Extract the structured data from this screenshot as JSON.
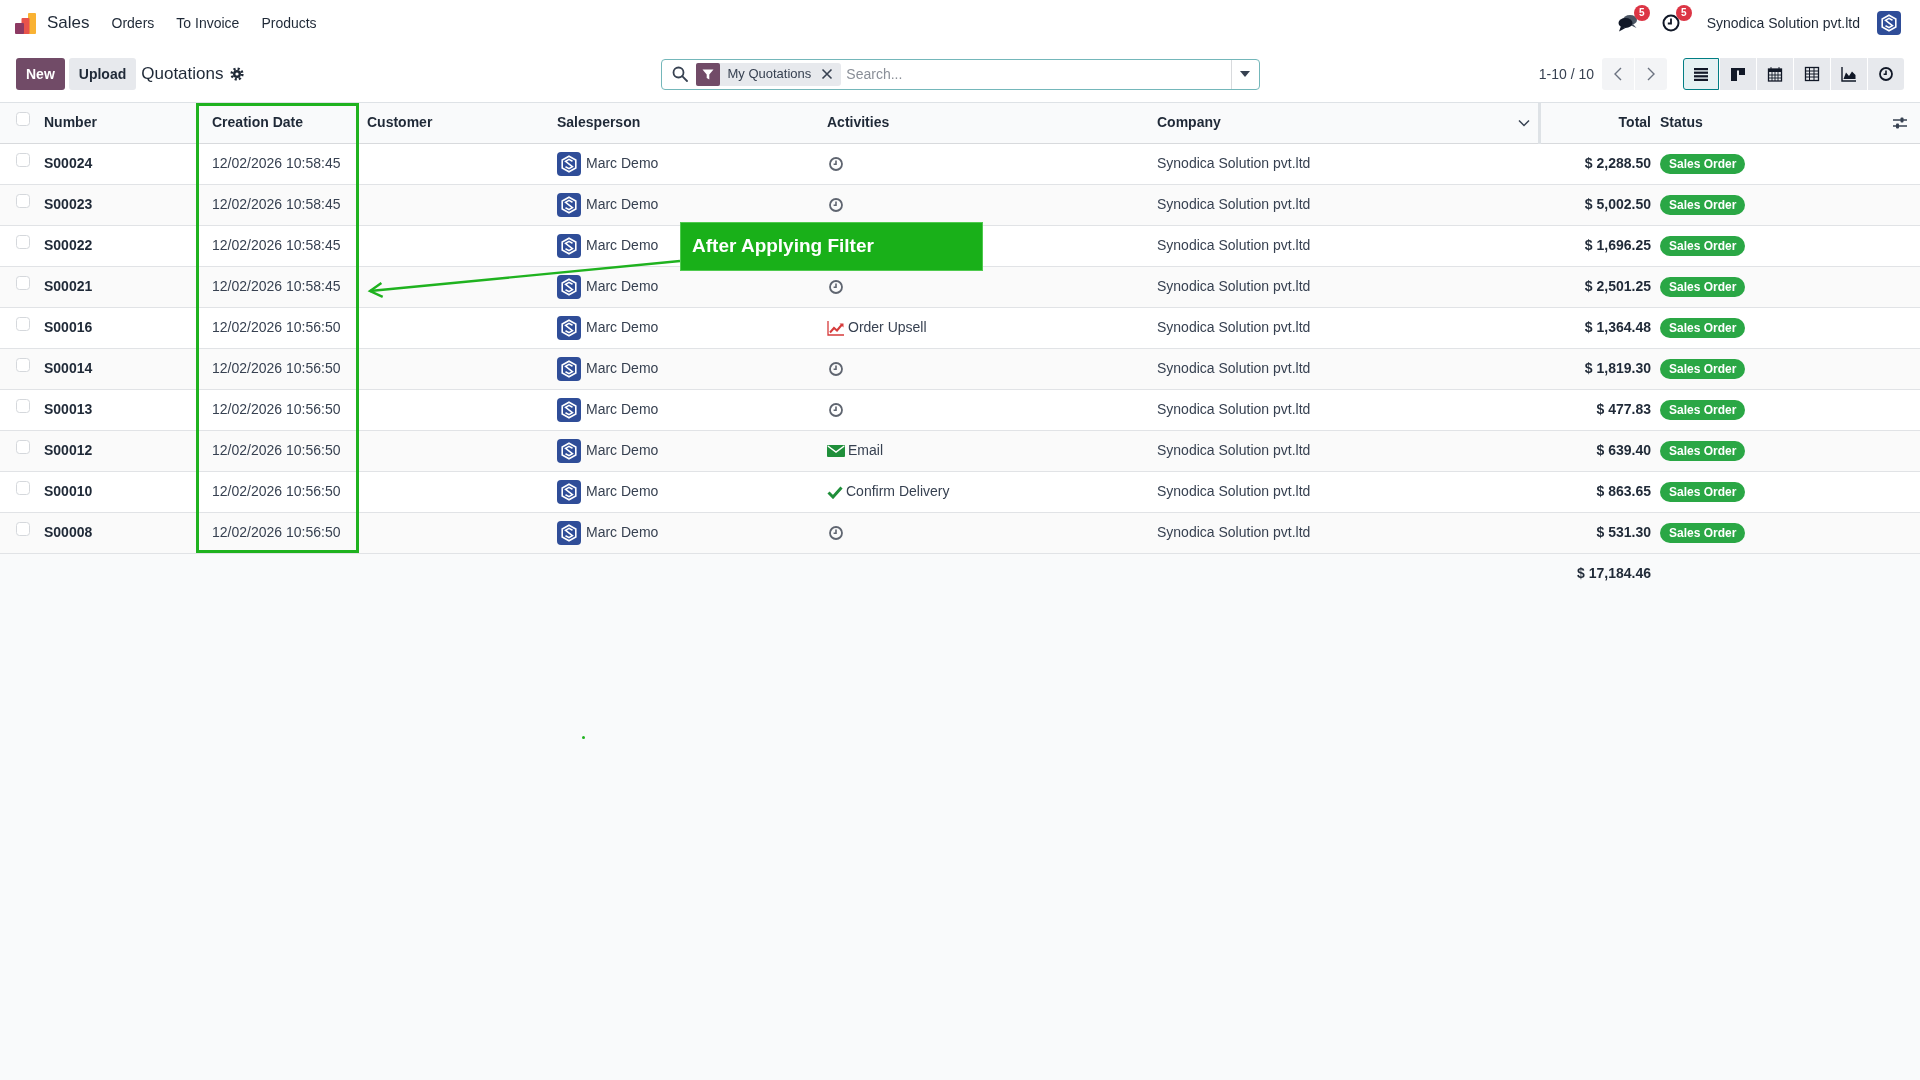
{
  "navbar": {
    "app_name": "Sales",
    "menu": [
      "Orders",
      "To Invoice",
      "Products"
    ],
    "messages_count": "5",
    "activities_count": "5",
    "company": "Synodica Solution pvt.ltd"
  },
  "control_panel": {
    "buttons": [
      {
        "label": "New",
        "kind": "primary"
      },
      {
        "label": "Upload",
        "kind": "secondary"
      }
    ],
    "title": "Quotations",
    "search": {
      "facets": [
        {
          "label": "My Quotations"
        }
      ],
      "placeholder": "Search..."
    },
    "pager": "1-10 / 10",
    "views": [
      {
        "kind": "list",
        "selected": true
      },
      {
        "kind": "kanban",
        "selected": false
      },
      {
        "kind": "calendar",
        "selected": false
      },
      {
        "kind": "pivot",
        "selected": false
      },
      {
        "kind": "graph",
        "selected": false
      },
      {
        "kind": "activity",
        "selected": false
      }
    ]
  },
  "table": {
    "select_all": {
      "checked": false
    },
    "columns": [
      {
        "label": "Number",
        "highlighted": false
      },
      {
        "label": "Creation Date",
        "highlighted": true
      },
      {
        "label": "Customer",
        "highlighted": false
      },
      {
        "label": "Salesperson",
        "highlighted": false
      },
      {
        "label": "Activities",
        "highlighted": false
      },
      {
        "label": "Company",
        "highlighted": false
      },
      {
        "label": "Total",
        "highlighted": false
      },
      {
        "label": "Status",
        "highlighted": false
      }
    ],
    "rows": [
      {
        "checked": false,
        "number": "S00024",
        "creation_date": "12/02/2026 10:58:45",
        "salesperson": "Marc Demo",
        "activity": {
          "kind": "clock"
        },
        "company": "Synodica Solution pvt.ltd",
        "total": "$ 2,288.50",
        "status": "Sales Order"
      },
      {
        "checked": false,
        "number": "S00023",
        "creation_date": "12/02/2026 10:58:45",
        "salesperson": "Marc Demo",
        "activity": {
          "kind": "clock"
        },
        "company": "Synodica Solution pvt.ltd",
        "total": "$ 5,002.50",
        "status": "Sales Order"
      },
      {
        "checked": false,
        "number": "S00022",
        "creation_date": "12/02/2026 10:58:45",
        "salesperson": "Marc Demo",
        "company": "Synodica Solution pvt.ltd",
        "total": "$ 1,696.25",
        "status": "Sales Order"
      },
      {
        "checked": false,
        "number": "S00021",
        "creation_date": "12/02/2026 10:58:45",
        "salesperson": "Marc Demo",
        "activity": {
          "kind": "clock"
        },
        "company": "Synodica Solution pvt.ltd",
        "total": "$ 2,501.25",
        "status": "Sales Order"
      },
      {
        "checked": false,
        "number": "S00016",
        "creation_date": "12/02/2026 10:56:50",
        "salesperson": "Marc Demo",
        "activity": {
          "kind": "upsell",
          "label": "Order Upsell"
        },
        "company": "Synodica Solution pvt.ltd",
        "total": "$ 1,364.48",
        "status": "Sales Order"
      },
      {
        "checked": false,
        "number": "S00014",
        "creation_date": "12/02/2026 10:56:50",
        "salesperson": "Marc Demo",
        "activity": {
          "kind": "clock"
        },
        "company": "Synodica Solution pvt.ltd",
        "total": "$ 1,819.30",
        "status": "Sales Order"
      },
      {
        "checked": false,
        "number": "S00013",
        "creation_date": "12/02/2026 10:56:50",
        "salesperson": "Marc Demo",
        "activity": {
          "kind": "clock"
        },
        "company": "Synodica Solution pvt.ltd",
        "total": "$ 477.83",
        "status": "Sales Order"
      },
      {
        "checked": false,
        "number": "S00012",
        "creation_date": "12/02/2026 10:56:50",
        "salesperson": "Marc Demo",
        "activity": {
          "kind": "email",
          "label": "Email"
        },
        "company": "Synodica Solution pvt.ltd",
        "total": "$ 639.40",
        "status": "Sales Order"
      },
      {
        "checked": false,
        "number": "S00010",
        "creation_date": "12/02/2026 10:56:50",
        "salesperson": "Marc Demo",
        "activity": {
          "kind": "check",
          "label": "Confirm Delivery"
        },
        "company": "Synodica Solution pvt.ltd",
        "total": "$ 863.65",
        "status": "Sales Order"
      },
      {
        "checked": false,
        "number": "S00008",
        "creation_date": "12/02/2026 10:56:50",
        "salesperson": "Marc Demo",
        "activity": {
          "kind": "clock"
        },
        "company": "Synodica Solution pvt.ltd",
        "total": "$ 531.30",
        "status": "Sales Order"
      }
    ],
    "total": "$ 17,184.46"
  },
  "annotation": {
    "label": "After Applying Filter"
  }
}
